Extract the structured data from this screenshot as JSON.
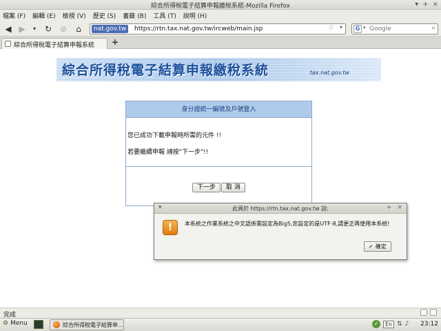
{
  "window": {
    "title": "綜合所得稅電子結算申報繳稅系統-Mozilla Firefox"
  },
  "menubar": {
    "items": [
      "檔案 (F)",
      "編輯 (E)",
      "檢視 (V)",
      "歷史 (S)",
      "書籤 (B)",
      "工具 (T)",
      "說明 (H)"
    ]
  },
  "navbar": {
    "site_badge": "nat.gov.tw",
    "url": "https://rtn.tax.nat.gov.tw/ircweb/main.jsp",
    "search_placeholder": "Google",
    "search_engine_icon": "google-icon"
  },
  "tabs": [
    {
      "label": "綜合所得稅電子結算申報系統",
      "active": true
    }
  ],
  "page": {
    "banner_title": "綜合所得稅電子結算申報繳稅系統",
    "banner_site": "tax.nat.gov.tw",
    "login_header": "身分證統一編號及戶號登入",
    "message_1": "您已成功下載申報時所需的元件 !!",
    "message_2": "若要繼續申報 請按\"下一步\"!!",
    "next_button": "下一步",
    "cancel_button": "取 消"
  },
  "dialog": {
    "title": "此頁於 https://rtn.tax.nat.gov.tw 說:",
    "message": "本系統之作業系統之中文語係需設定為Big5,您設定的是UTF-8,請更正再使用本系統!",
    "ok_button": "確定",
    "icon": "warning-icon"
  },
  "statusbar": {
    "text": "完成"
  },
  "taskbar": {
    "menu_label": "Menu",
    "task_label": "綜合所得稅電子結算申…",
    "language": "En",
    "clock": "23:12"
  },
  "colors": {
    "login_header_bg": "#aecbeb",
    "banner_title": "#1a4f9c",
    "url_badge_bg": "#4a6db3"
  }
}
